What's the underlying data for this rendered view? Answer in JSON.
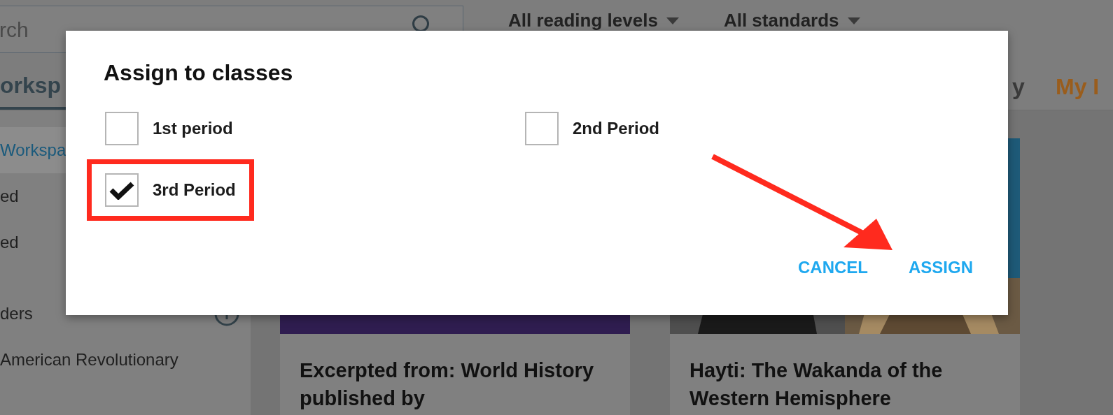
{
  "search": {
    "value": "rch"
  },
  "filters": [
    {
      "label": "All reading levels"
    },
    {
      "label": "All standards"
    }
  ],
  "tabs": [
    {
      "label": "orksp",
      "selected": true
    },
    {
      "label": "y",
      "selected": false
    },
    {
      "label": "My I",
      "selected": false,
      "color": "#9a5d1c"
    }
  ],
  "sidebar": {
    "items": [
      {
        "label": "Workspa",
        "selected": true,
        "kind": "link"
      },
      {
        "label": "ed",
        "selected": false,
        "kind": "link"
      },
      {
        "label": "ed",
        "selected": false,
        "kind": "link"
      },
      {
        "label": "ders",
        "selected": false,
        "kind": "section"
      },
      {
        "label": "American Revolutionary",
        "selected": false,
        "kind": "link"
      }
    ]
  },
  "cards": [
    {
      "title": "Excerpted from: World History published by",
      "kind": "color"
    },
    {
      "title": "Hayti: The Wakanda of the Western Hemisphere",
      "kind": "picture"
    }
  ],
  "dialog": {
    "title": "Assign to classes",
    "classes": [
      {
        "label": "1st period",
        "checked": false,
        "highlighted": false
      },
      {
        "label": "2nd Period",
        "checked": false,
        "highlighted": false
      },
      {
        "label": "3rd Period",
        "checked": true,
        "highlighted": true
      }
    ],
    "buttons": [
      "CANCEL",
      "ASSIGN"
    ]
  }
}
